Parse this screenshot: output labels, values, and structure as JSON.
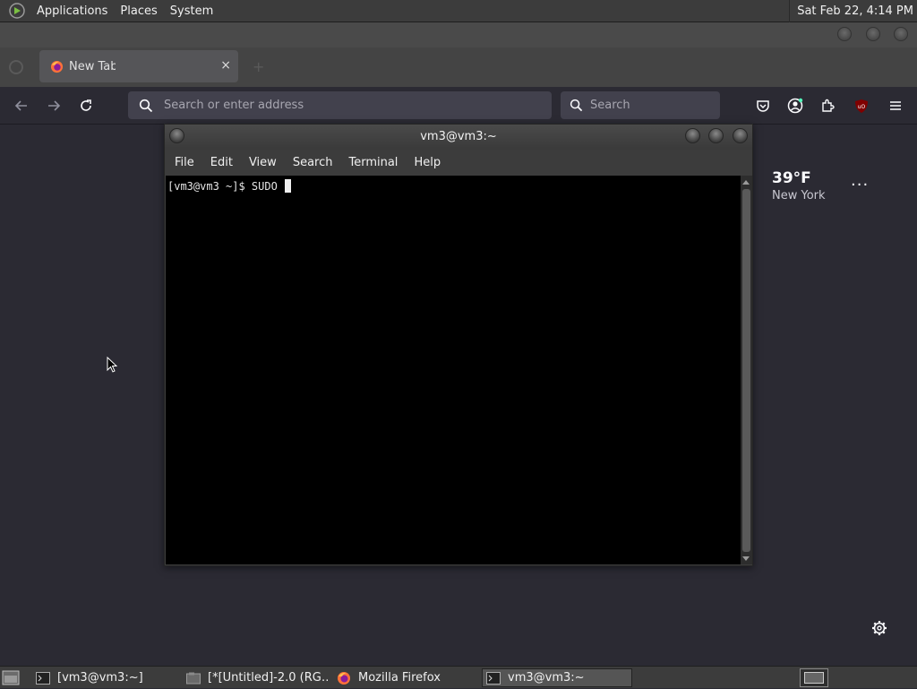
{
  "top_panel": {
    "menus": [
      "Applications",
      "Places",
      "System"
    ],
    "clock": "Sat Feb 22,  4:14 PM"
  },
  "firefox": {
    "tab": {
      "label": "New Tab",
      "close": "×"
    },
    "address_placeholder": "Search or enter address",
    "search_placeholder": "Search"
  },
  "weather": {
    "temperature": "39°F",
    "city": "New York",
    "menu": "···"
  },
  "terminal": {
    "title": "vm3@vm3:~",
    "menus": [
      "File",
      "Edit",
      "View",
      "Search",
      "Terminal",
      "Help"
    ],
    "prompt": "[vm3@vm3 ~]$ SUDO"
  },
  "taskbar": {
    "tasks": [
      {
        "label": "[vm3@vm3:~]",
        "icon": "terminal-icon",
        "active": false
      },
      {
        "label": "[*[Untitled]-2.0 (RG…",
        "icon": "gimp-icon",
        "active": false
      },
      {
        "label": "Mozilla Firefox",
        "icon": "firefox-icon",
        "active": false
      },
      {
        "label": "vm3@vm3:~",
        "icon": "terminal-icon",
        "active": true
      }
    ]
  }
}
